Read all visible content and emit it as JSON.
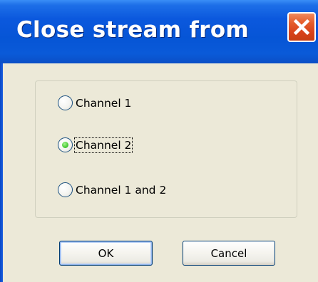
{
  "window": {
    "title": "Close stream from"
  },
  "close_button": {
    "icon": "close-icon",
    "color": "#d8421a"
  },
  "options": [
    {
      "label": "Channel 1",
      "checked": false
    },
    {
      "label": "Channel 2",
      "checked": true
    },
    {
      "label": "Channel 1 and 2",
      "checked": false
    }
  ],
  "buttons": {
    "ok_label": "OK",
    "cancel_label": "Cancel"
  },
  "colors": {
    "titlebar": "#0655d6",
    "dialog_background": "#ece9d8",
    "radio_selected": "#4fcf3a"
  }
}
